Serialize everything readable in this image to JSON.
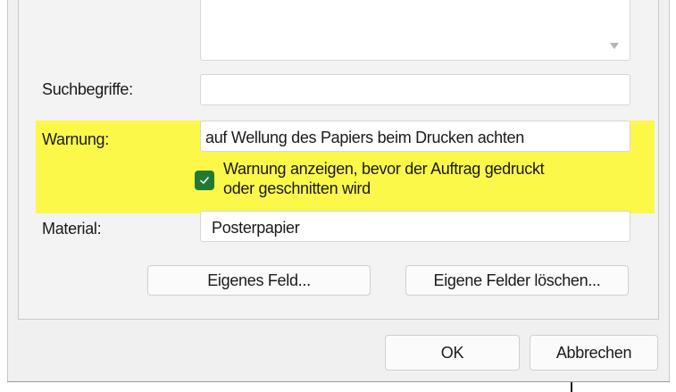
{
  "form": {
    "search_terms_label": "Suchbegriffe:",
    "search_terms_value": "",
    "warning_label": "Warnung:",
    "warning_value": "auf Wellung des Papiers beim Drucken achten",
    "show_warning_line1": "Warnung anzeigen, bevor der Auftrag gedruckt",
    "show_warning_line2": "oder geschnitten wird",
    "show_warning_checked": true,
    "material_label": "Material:",
    "material_value": "Posterpapier"
  },
  "buttons": {
    "custom_field": "Eigenes Feld...",
    "delete_custom_fields": "Eigene Felder löschen...",
    "ok": "OK",
    "cancel": "Abbrechen"
  },
  "colors": {
    "highlight": "#fbf84a",
    "checkbox": "#217a33"
  },
  "icons": {
    "scroll_down": "chevron-down-icon",
    "checkbox": "checkmark-icon"
  }
}
